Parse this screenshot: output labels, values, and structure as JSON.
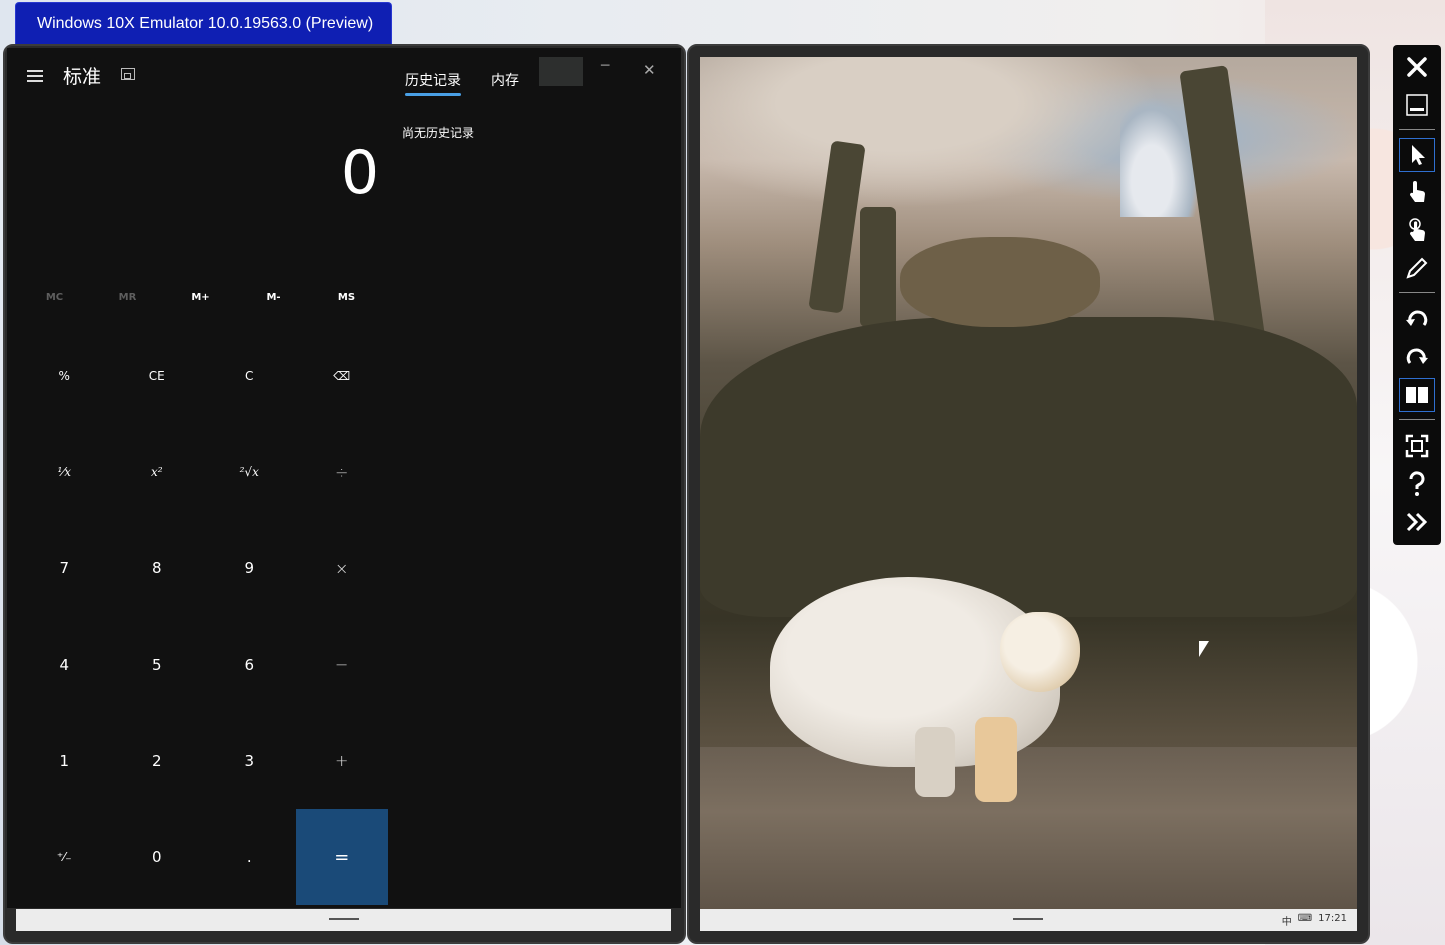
{
  "window_title": "Windows 10X Emulator 10.0.19563.0 (Preview)",
  "calculator": {
    "mode_title": "标准",
    "tabs": {
      "history": "历史记录",
      "memory": "内存"
    },
    "no_history": "尚无历史记录",
    "display": "0",
    "window_controls": {
      "minimize": "─",
      "close": "✕"
    },
    "memory_buttons": [
      {
        "label": "MC",
        "enabled": false
      },
      {
        "label": "MR",
        "enabled": false
      },
      {
        "label": "M+",
        "enabled": true
      },
      {
        "label": "M-",
        "enabled": true
      },
      {
        "label": "MS",
        "enabled": true
      }
    ],
    "keys": [
      {
        "label": "%",
        "name": "percent-key"
      },
      {
        "label": "CE",
        "name": "clear-entry-key"
      },
      {
        "label": "C",
        "name": "clear-key"
      },
      {
        "label": "⌫",
        "name": "backspace-key"
      },
      {
        "label": "¹⁄x",
        "name": "reciprocal-key"
      },
      {
        "label": "x²",
        "name": "square-key"
      },
      {
        "label": "²√x",
        "name": "square-root-key"
      },
      {
        "label": "÷",
        "name": "divide-key"
      },
      {
        "label": "7",
        "name": "digit-7-key"
      },
      {
        "label": "8",
        "name": "digit-8-key"
      },
      {
        "label": "9",
        "name": "digit-9-key"
      },
      {
        "label": "×",
        "name": "multiply-key"
      },
      {
        "label": "4",
        "name": "digit-4-key"
      },
      {
        "label": "5",
        "name": "digit-5-key"
      },
      {
        "label": "6",
        "name": "digit-6-key"
      },
      {
        "label": "−",
        "name": "subtract-key"
      },
      {
        "label": "1",
        "name": "digit-1-key"
      },
      {
        "label": "2",
        "name": "digit-2-key"
      },
      {
        "label": "3",
        "name": "digit-3-key"
      },
      {
        "label": "+",
        "name": "add-key"
      },
      {
        "label": "⁺⁄₋",
        "name": "negate-key"
      },
      {
        "label": "0",
        "name": "digit-0-key"
      },
      {
        "label": ".",
        "name": "decimal-key"
      },
      {
        "label": "=",
        "name": "equals-key"
      }
    ]
  },
  "taskbar": {
    "ime": "中",
    "ime_mode_icon": "keyboard-icon",
    "clock": "17:21"
  },
  "toolbar_icons": [
    "close-icon",
    "minimize-icon",
    "mouse-pointer-icon",
    "single-touch-icon",
    "multi-touch-icon",
    "pen-icon",
    "rotate-left-icon",
    "rotate-right-icon",
    "dual-screen-icon",
    "fit-to-screen-icon",
    "help-icon",
    "expand-tools-icon"
  ],
  "colors": {
    "title_tab": "#0f1fb3",
    "equals_key": "#1a4a78",
    "tab_underline": "#4aa0e6"
  }
}
